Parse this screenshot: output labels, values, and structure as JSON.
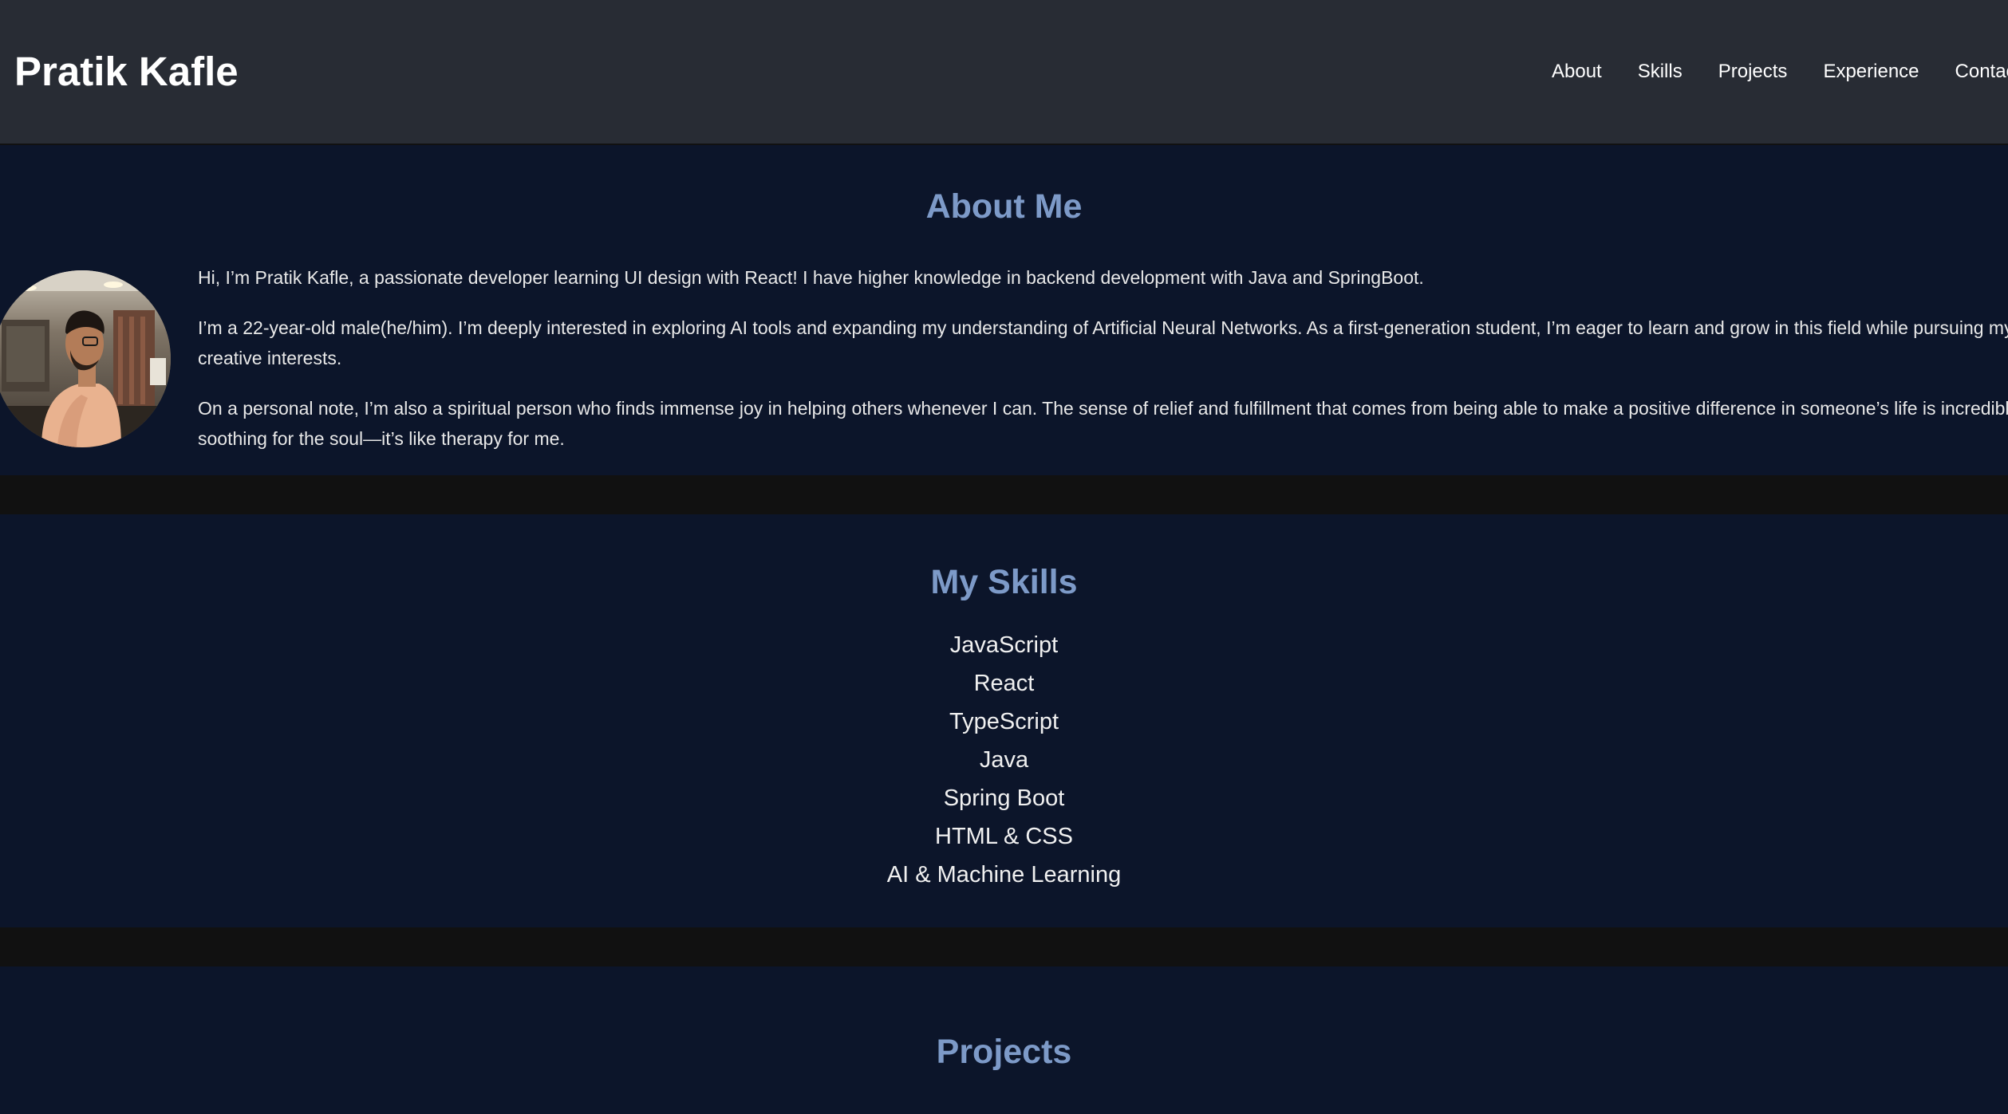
{
  "header": {
    "brand": "Pratik Kafle",
    "nav": [
      "About",
      "Skills",
      "Projects",
      "Experience",
      "Contact"
    ]
  },
  "about": {
    "title": "About Me",
    "paragraphs": [
      "Hi, I’m Pratik Kafle, a passionate developer learning UI design with React! I have higher knowledge in backend development with Java and SpringBoot.",
      "I’m a 22-year-old male(he/him). I’m deeply interested in exploring AI tools and expanding my understanding of Artificial Neural Networks. As a first-generation student, I’m eager to learn and grow in this field while pursuing my creative interests.",
      "On a personal note, I’m also a spiritual person who finds immense joy in helping others whenever I can. The sense of relief and fulfillment that comes from being able to make a positive difference in someone’s life is incredibly soothing for the soul—it’s like therapy for me."
    ]
  },
  "skills": {
    "title": "My Skills",
    "items": [
      "JavaScript",
      "React",
      "TypeScript",
      "Java",
      "Spring Boot",
      "HTML & CSS",
      "AI & Machine Learning"
    ]
  },
  "projects": {
    "title": "Projects"
  },
  "colors": {
    "header_bg": "#282c34",
    "section_bg": "#0c152a",
    "divider_bg": "#111111",
    "heading": "#7d9ac8",
    "text": "#e8e8e8"
  },
  "icons": {
    "avatar": "profile-photo"
  }
}
